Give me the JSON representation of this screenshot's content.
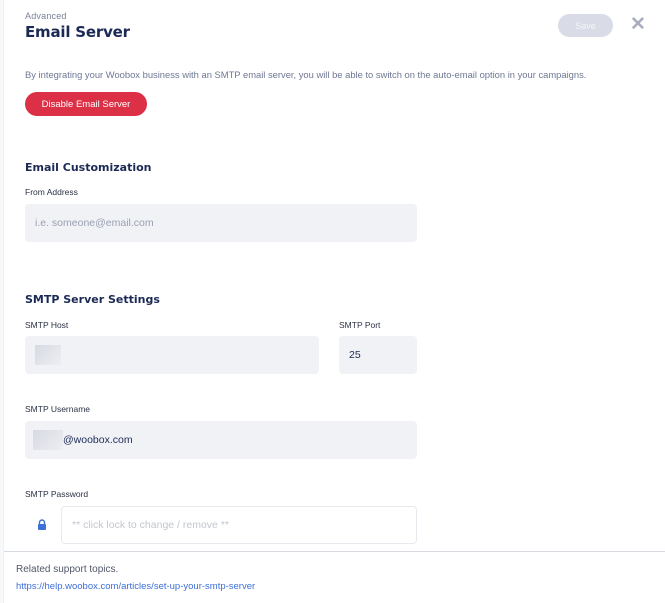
{
  "header": {
    "eyebrow": "Advanced",
    "title": "Email Server",
    "save_label": "Save",
    "close_icon": "close-icon"
  },
  "intro": {
    "description": "By integrating your Woobox business with an SMTP email server, you will be able to switch on the auto-email option in your campaigns.",
    "disable_label": "Disable Email Server"
  },
  "email_customization": {
    "title": "Email Customization",
    "from_address": {
      "label": "From Address",
      "value": "",
      "placeholder": "i.e. someone@email.com"
    }
  },
  "smtp": {
    "title": "SMTP Server Settings",
    "host": {
      "label": "SMTP Host",
      "value": "[redacted]"
    },
    "port": {
      "label": "SMTP Port",
      "value": "25"
    },
    "username": {
      "label": "SMTP Username",
      "value_suffix": "@woobox.com",
      "value_prefix": "[redacted]"
    },
    "password": {
      "label": "SMTP Password",
      "placeholder": "** click lock to change / remove **",
      "lock_icon": "lock-icon",
      "lock_color": "#3d6fd8"
    }
  },
  "footer": {
    "related_text": "Related support topics.",
    "link_text": "https://help.woobox.com/articles/set-up-your-smtp-server"
  },
  "colors": {
    "primary_text": "#1b2a55",
    "danger": "#dc3046",
    "save_disabled": "#d9dce6",
    "link": "#3d6fd8"
  }
}
